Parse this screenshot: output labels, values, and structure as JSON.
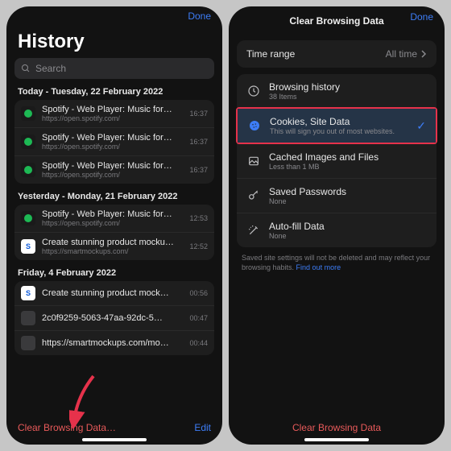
{
  "left": {
    "done": "Done",
    "title": "History",
    "search_placeholder": "Search",
    "sections": [
      {
        "header": "Today - Tuesday, 22 February 2022",
        "items": [
          {
            "icon": "spotify",
            "title": "Spotify - Web Player: Music for…",
            "sub": "https://open.spotify.com/",
            "time": "16:37"
          },
          {
            "icon": "spotify",
            "title": "Spotify - Web Player: Music for…",
            "sub": "https://open.spotify.com/",
            "time": "16:37"
          },
          {
            "icon": "spotify",
            "title": "Spotify - Web Player: Music for…",
            "sub": "https://open.spotify.com/",
            "time": "16:37"
          }
        ]
      },
      {
        "header": "Yesterday - Monday, 21 February 2022",
        "items": [
          {
            "icon": "spotify",
            "title": "Spotify - Web Player: Music for…",
            "sub": "https://open.spotify.com/",
            "time": "12:53"
          },
          {
            "icon": "sm",
            "title": "Create stunning product mocku…",
            "sub": "https://smartmockups.com/",
            "time": "12:52"
          }
        ]
      },
      {
        "header": "Friday, 4 February 2022",
        "items": [
          {
            "icon": "sm",
            "title": "Create stunning product mock…",
            "sub": "https://smartmockups.com/",
            "time": "00:56"
          },
          {
            "icon": "blank",
            "title": "2c0f9259-5063-47aa-92dc-5…",
            "sub": "",
            "time": "00:47"
          },
          {
            "icon": "blank",
            "title": "https://smartmockups.com/mo…",
            "sub": "",
            "time": "00:44"
          }
        ]
      }
    ],
    "clear": "Clear Browsing Data…",
    "edit": "Edit"
  },
  "right": {
    "title": "Clear Browsing Data",
    "done": "Done",
    "range_label": "Time range",
    "range_value": "All time",
    "options": [
      {
        "icon": "history",
        "t1": "Browsing history",
        "t2": "38 Items",
        "selected": false
      },
      {
        "icon": "cookie",
        "t1": "Cookies, Site Data",
        "t2": "This will sign you out of most websites.",
        "selected": true,
        "highlight": true
      },
      {
        "icon": "image",
        "t1": "Cached Images and Files",
        "t2": "Less than 1 MB",
        "selected": false
      },
      {
        "icon": "key",
        "t1": "Saved Passwords",
        "t2": "None",
        "selected": false
      },
      {
        "icon": "wand",
        "t1": "Auto-fill Data",
        "t2": "None",
        "selected": false
      }
    ],
    "note_a": "Saved site settings will not be deleted and may reflect your browsing habits. ",
    "note_link": "Find out more",
    "clear": "Clear Browsing Data"
  }
}
